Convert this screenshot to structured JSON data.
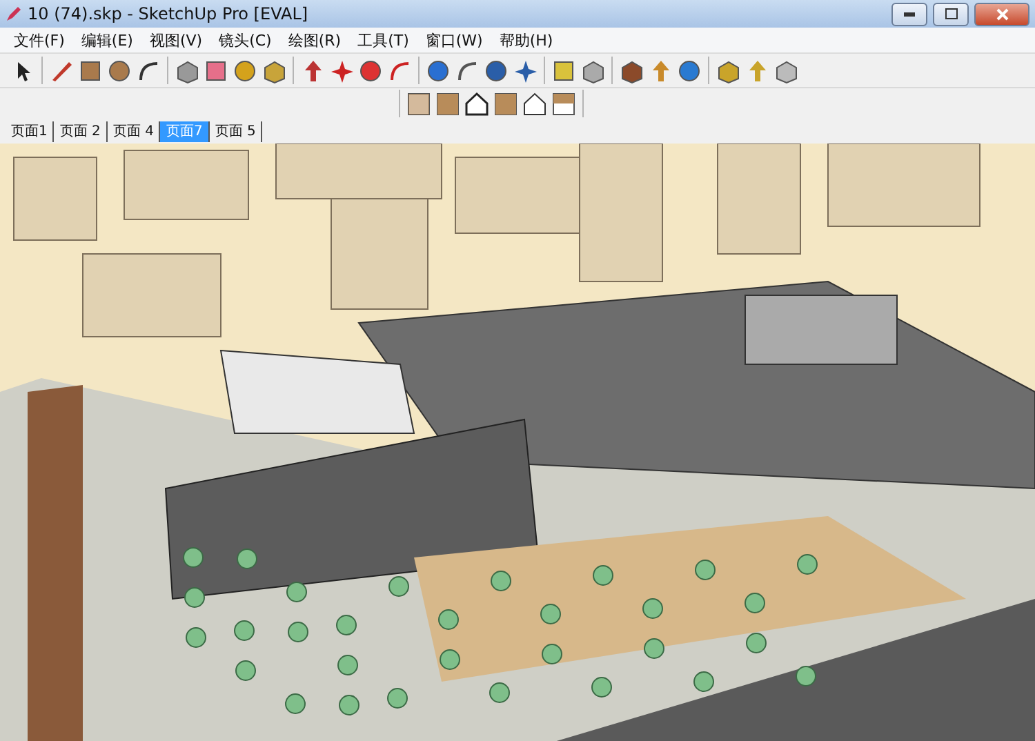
{
  "window": {
    "title": "10 (74).skp - SketchUp Pro [EVAL]"
  },
  "menu": [
    "文件(F)",
    "编辑(E)",
    "视图(V)",
    "镜头(C)",
    "绘图(R)",
    "工具(T)",
    "窗口(W)",
    "帮助(H)"
  ],
  "tabs": [
    {
      "label": "页面1",
      "selected": false
    },
    {
      "label": "页面 2",
      "selected": false
    },
    {
      "label": "页面 4",
      "selected": false
    },
    {
      "label": "页面7",
      "selected": true
    },
    {
      "label": "页面 5",
      "selected": false
    }
  ]
}
